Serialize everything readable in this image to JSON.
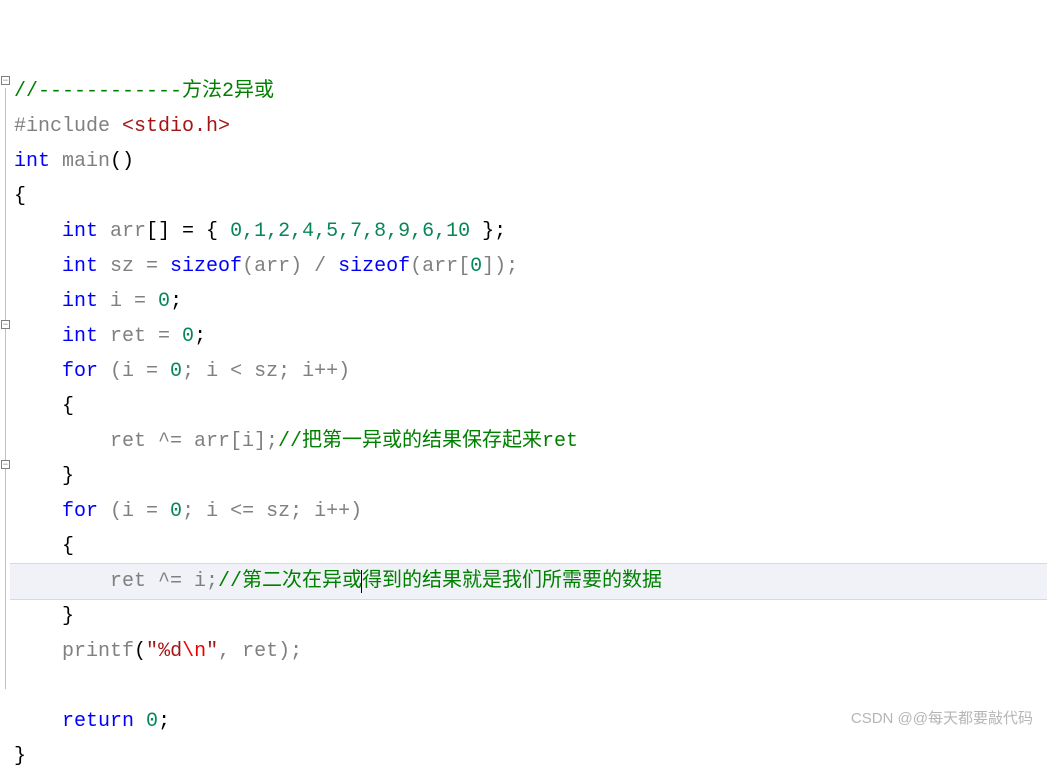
{
  "code": {
    "line1_comment": "//------------方法2异或",
    "line2_preproc": "#include ",
    "line2_include": "<stdio.h>",
    "line3_int": "int",
    "line3_main": " main",
    "line3_paren": "()",
    "line4_brace": "{",
    "line5_indent": "    ",
    "line5_int": "int",
    "line5_arr": " arr",
    "line5_brackets": "[] = { ",
    "line5_values": "0,1,2,4,5,7,8,9,6,10",
    "line5_end": " };",
    "line6_indent": "    ",
    "line6_int": "int",
    "line6_sz": " sz = ",
    "line6_sizeof1": "sizeof",
    "line6_p1": "(arr) / ",
    "line6_sizeof2": "sizeof",
    "line6_p2": "(arr[",
    "line6_zero": "0",
    "line6_p3": "]);",
    "line7_indent": "    ",
    "line7_int": "int",
    "line7_rest": " i = ",
    "line7_zero": "0",
    "line7_semi": ";",
    "line8_indent": "    ",
    "line8_int": "int",
    "line8_rest": " ret = ",
    "line8_zero": "0",
    "line8_semi": ";",
    "line9_indent": "    ",
    "line9_for": "for",
    "line9_p1": " (i = ",
    "line9_z1": "0",
    "line9_p2": "; i < sz; i++)",
    "line10": "    {",
    "line11_indent": "        ret ^= arr[i];",
    "line11_comment": "//把第一异或的结果保存起来ret",
    "line12": "    }",
    "line13_indent": "    ",
    "line13_for": "for",
    "line13_p1": " (i = ",
    "line13_z1": "0",
    "line13_p2": "; i <= sz; i++)",
    "line14": "    {",
    "line15_indent": "        ret ^= i;",
    "line15_comment_p1": "//第二次在异或",
    "line15_comment_p2": "得到的结果就是我们所需要的数据",
    "line16": "    }",
    "line17_indent": "    ",
    "line17_printf": "printf",
    "line17_p1": "(",
    "line17_q1": "\"",
    "line17_fmt": "%d",
    "line17_esc": "\\n",
    "line17_q2": "\"",
    "line17_p2": ", ret);",
    "line18": "",
    "line19_indent": "    ",
    "line19_return": "return",
    "line19_sp": " ",
    "line19_zero": "0",
    "line19_semi": ";",
    "line20": "}"
  },
  "watermark": "CSDN @@每天都要敲代码"
}
